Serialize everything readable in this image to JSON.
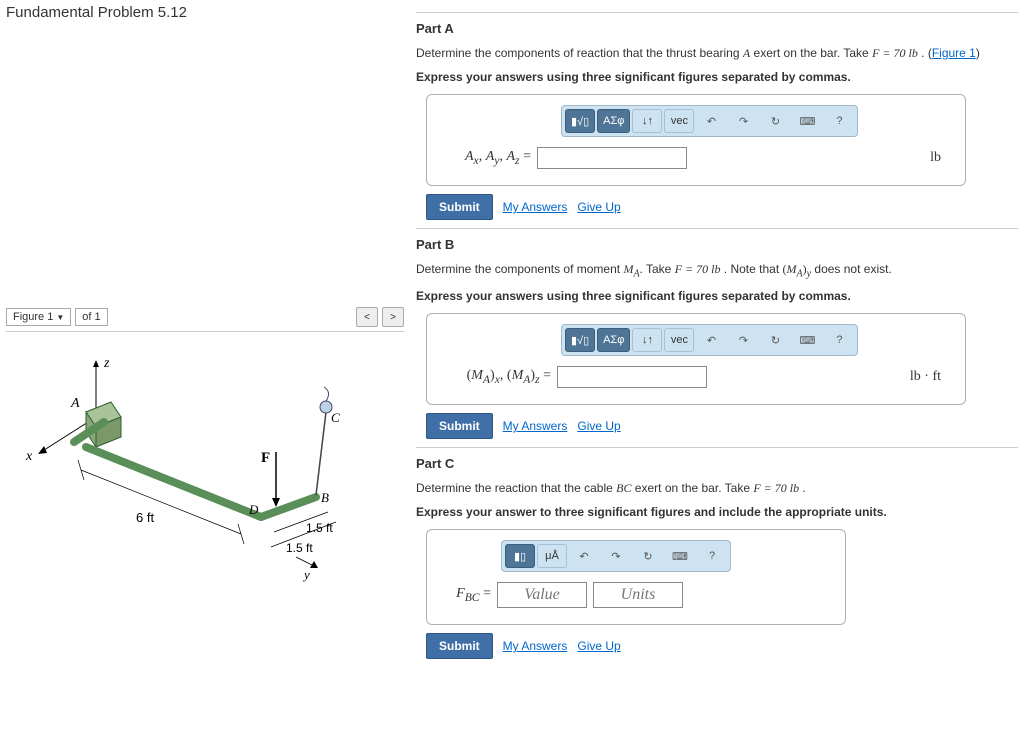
{
  "title": "Fundamental Problem 5.12",
  "figureBar": {
    "label": "Figure 1",
    "of": "of 1",
    "prev": "<",
    "next": ">"
  },
  "figure": {
    "A": "A",
    "B": "B",
    "C": "C",
    "D": "D",
    "F": "F",
    "x": "x",
    "y": "y",
    "z": "z",
    "d1": "6 ft",
    "d2": "1.5 ft",
    "d3": "1.5 ft"
  },
  "partA": {
    "title": "Part A",
    "prompt_pre": "Determine the components of reaction that the thrust bearing ",
    "A": "A",
    "prompt_mid": " exert on the bar. Take ",
    "Feq": "F = 70 lb",
    "prompt_post": " . (",
    "figLink": "Figure 1",
    "post2": ")",
    "instr": "Express your answers using three significant figures separated by commas.",
    "vars": "Aₓ, A_y, A_z =",
    "unit": "lb"
  },
  "partB": {
    "title": "Part B",
    "p_pre": "Determine the components of moment ",
    "MA": "M_A",
    "p_mid": ". Take ",
    "Feq": "F = 70 lb",
    "p_note": " . Note that ",
    "MAy": "(M_A)_y",
    "p_end": " does not exist.",
    "instr": "Express your answers using three significant figures separated by commas.",
    "vars": "(M_A)_x, (M_A)_z =",
    "unit": "lb · ft"
  },
  "partC": {
    "title": "Part C",
    "p_pre": "Determine the reaction that the cable ",
    "BC": "BC",
    "p_mid": " exert on the bar. Take ",
    "Feq": "F = 70 lb",
    "p_end": " .",
    "instr": "Express your answer to three significant figures and include the appropriate units.",
    "vars": "F_BC =",
    "valuePH": "Value",
    "unitsPH": "Units"
  },
  "tools": {
    "tmpl": "▮√▯",
    "greek": "ΑΣφ",
    "arrows": "↓↑",
    "vec": "vec",
    "undo": "↶",
    "redo": "↷",
    "reset": "↻",
    "kbd": "⌨",
    "help": "?",
    "frac": "▮▯",
    "mu": "μÅ"
  },
  "buttons": {
    "submit": "Submit",
    "myAnswers": "My Answers",
    "giveUp": "Give Up"
  }
}
